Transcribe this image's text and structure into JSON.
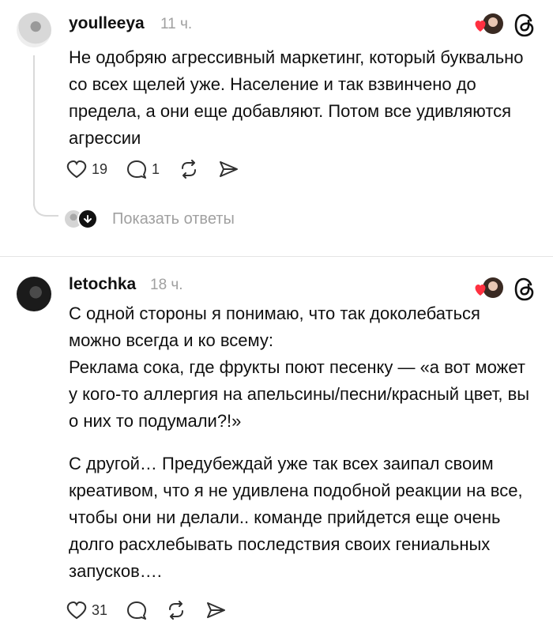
{
  "posts": [
    {
      "username": "youlleeya",
      "time": "11 ч.",
      "paragraphs": [
        "Не одобряю агрессивный маркетинг, который буквально со всех щелей уже.  Население и так взвинчено до предела, а они еще добавляют. Потом все удивляются агрессии"
      ],
      "likes": "19",
      "replies": "1",
      "show_replies": "Показать ответы"
    },
    {
      "username": "letochka",
      "time": "18 ч.",
      "paragraphs": [
        "С одной стороны я понимаю, что так доколебаться можно всегда и ко всему:",
        "Реклама сока, где фрукты поют песенку — «а вот может у кого-то аллергия на апельсины/песни/красный цвет, вы о них то подумали?!»",
        "С другой… Предубеждай уже так всех заипал своим креативом, что я не удивлена подобной реакции на все, чтобы они ни делали.. команде прийдется еще очень долго расхлебывать последствия своих гениальных запусков…."
      ],
      "likes": "31"
    }
  ],
  "colors": {
    "heart": "#ff3040",
    "muted": "#a0a0a0",
    "text": "#101010"
  },
  "icons": [
    "heart-icon",
    "comment-icon",
    "repost-icon",
    "share-icon",
    "threads-logo-icon",
    "liked-by-heart-icon"
  ]
}
